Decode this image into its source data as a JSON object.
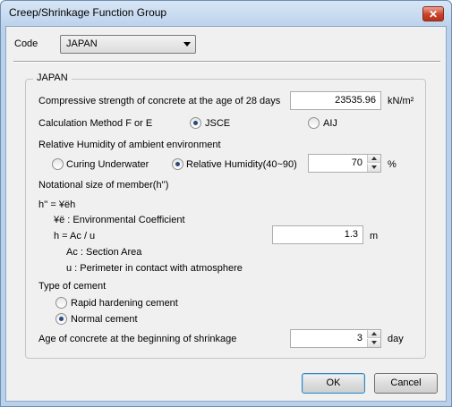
{
  "window": {
    "title": "Creep/Shrinkage Function Group",
    "close_glyph": "✕"
  },
  "code": {
    "label": "Code",
    "value": "JAPAN"
  },
  "group": {
    "label": "JAPAN",
    "compressive": {
      "label": "Compressive strength of concrete at the age of 28 days",
      "value": "23535.96",
      "unit": "kN/m²"
    },
    "calc": {
      "label": "Calculation Method F or E",
      "options": [
        "JSCE",
        "AIJ"
      ],
      "selected": "JSCE"
    },
    "humidity": {
      "label": "Relative Humidity of ambient environment",
      "opt1": "Curing Underwater",
      "opt2": "Relative Humidity(40~90)",
      "selected": "Relative Humidity(40~90)",
      "value": "70",
      "unit": "%"
    },
    "notational": {
      "label": "Notational size of member(h'')",
      "formula1": "h'' = ¥ëh",
      "formula2": "¥ë : Environmental Coefficient",
      "formula3": "h = Ac / u",
      "value": "1.3",
      "unit": "m",
      "formula4": "Ac : Section Area",
      "formula5": "u : Perimeter in contact with atmosphere"
    },
    "cement": {
      "label": "Type of cement",
      "opt1": "Rapid hardening cement",
      "opt2": "Normal cement",
      "selected": "Normal cement"
    },
    "age": {
      "label": "Age of concrete at the beginning of shrinkage",
      "value": "3",
      "unit": "day"
    }
  },
  "buttons": {
    "ok": "OK",
    "cancel": "Cancel"
  }
}
